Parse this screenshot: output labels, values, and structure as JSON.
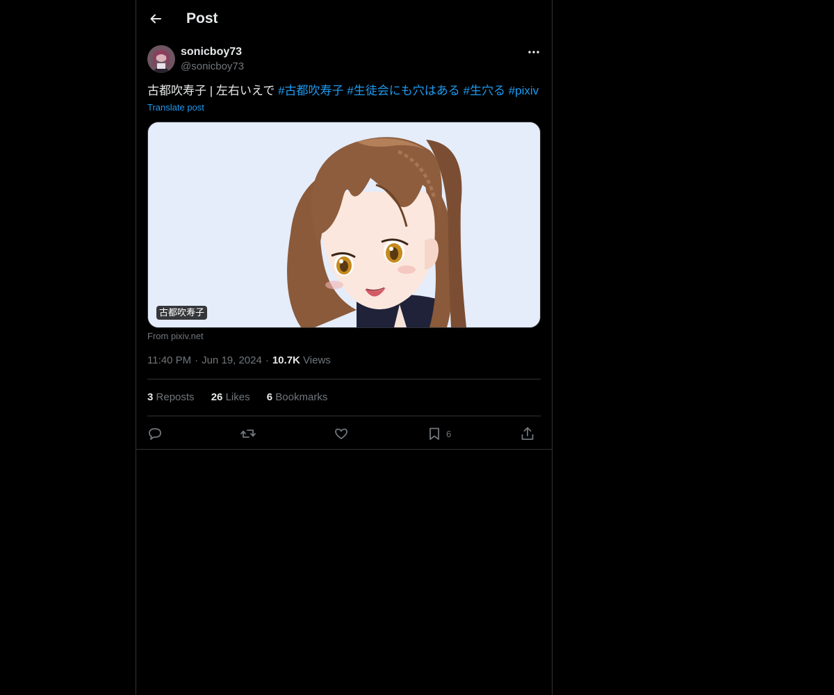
{
  "header": {
    "title": "Post",
    "back_icon": "arrow-left-icon"
  },
  "post": {
    "author": {
      "display_name": "sonicboy73",
      "handle": "@sonicboy73"
    },
    "text_plain": "古都吹寿子 | 左右いえで",
    "hashtags": [
      "#古都吹寿子",
      "#生徒会にも穴はある",
      "#生穴る",
      "#pixiv"
    ],
    "translate_label": "Translate post",
    "media": {
      "label": "古都吹寿子"
    },
    "source": "From pixiv.net",
    "time": "11:40 PM",
    "date": "Jun 19, 2024",
    "views_count": "10.7K",
    "views_label": "Views",
    "stats": {
      "reposts_count": "3",
      "reposts_label": "Reposts",
      "likes_count": "26",
      "likes_label": "Likes",
      "bookmarks_count": "6",
      "bookmarks_label": "Bookmarks"
    },
    "actions": {
      "reply_icon": "reply-icon",
      "repost_icon": "repost-icon",
      "like_icon": "heart-icon",
      "bookmark_icon": "bookmark-icon",
      "bookmark_count": "6",
      "share_icon": "share-icon"
    }
  },
  "colors": {
    "background": "#000000",
    "text_primary": "#e7e9ea",
    "text_secondary": "#71767b",
    "accent": "#1d9bf0",
    "border": "#2f3336"
  }
}
